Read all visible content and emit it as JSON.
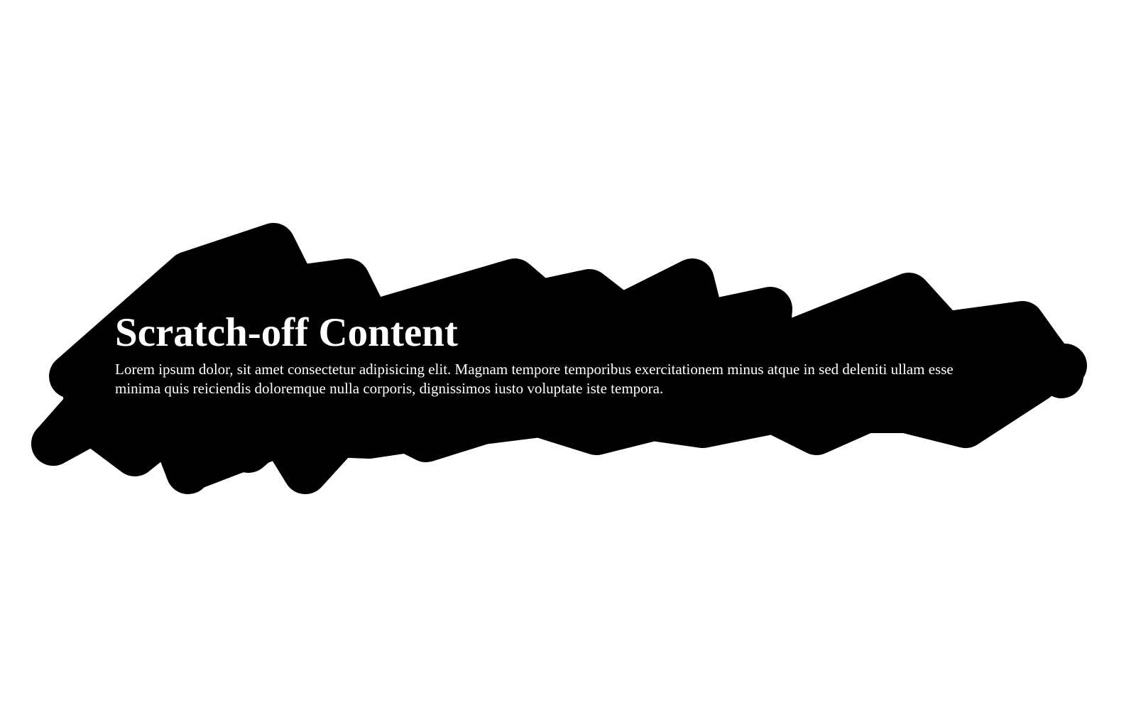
{
  "card": {
    "title": "Scratch-off Content",
    "body": "Lorem ipsum dolor, sit amet consectetur adipisicing elit. Magnam tempore temporibus exercitationem minus atque in sed deleniti ullam esse minima quis reiciendis doloremque nulla corporis, dignissimos iusto voluptate iste tempora."
  },
  "colors": {
    "background": "#ffffff",
    "scratch_cover": "#000000",
    "text": "#ffffff"
  }
}
